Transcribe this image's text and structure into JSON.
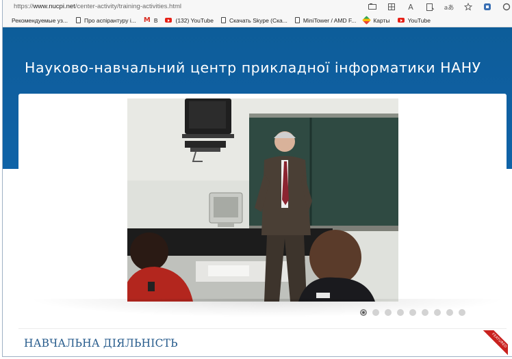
{
  "browser": {
    "url_prefix": "https://",
    "url_host": "www.nucpi.net",
    "url_path": "/center-activity/training-activities.html",
    "toolbar_icons": [
      "tab-icon",
      "grid-icon",
      "read-aloud-icon",
      "immersive-reader-icon",
      "translate-icon",
      "favorite-add-icon",
      "extension-icon",
      "settings-icon"
    ],
    "read_aloud_glyph": "A",
    "translate_glyph": "aあ"
  },
  "bookmarks": [
    {
      "label": "Рекомендуемые уз...",
      "icon": "none"
    },
    {
      "label": "Про аспірантуру і...",
      "icon": "doc-icon"
    },
    {
      "label": "В",
      "icon": "gmail-icon"
    },
    {
      "label": "(132) YouTube",
      "icon": "youtube-icon"
    },
    {
      "label": "Скачать Skype (Ска...",
      "icon": "doc-icon"
    },
    {
      "label": "MiniTower / AMD F...",
      "icon": "doc-icon"
    },
    {
      "label": "Карты",
      "icon": "maps-icon"
    },
    {
      "label": "YouTube",
      "icon": "youtube-icon"
    }
  ],
  "site": {
    "title": "Науково-навчальний центр прикладної інформатики НАНУ"
  },
  "slider": {
    "slide_count": 9,
    "active_index": 0
  },
  "section": {
    "title": "НАВЧАЛЬНА ДІЯЛЬНІСТЬ",
    "badge": "FEATURED"
  },
  "colors": {
    "header_blue": "#0f5fa0",
    "section_title": "#255a8b",
    "ribbon_red": "#c9211e"
  }
}
